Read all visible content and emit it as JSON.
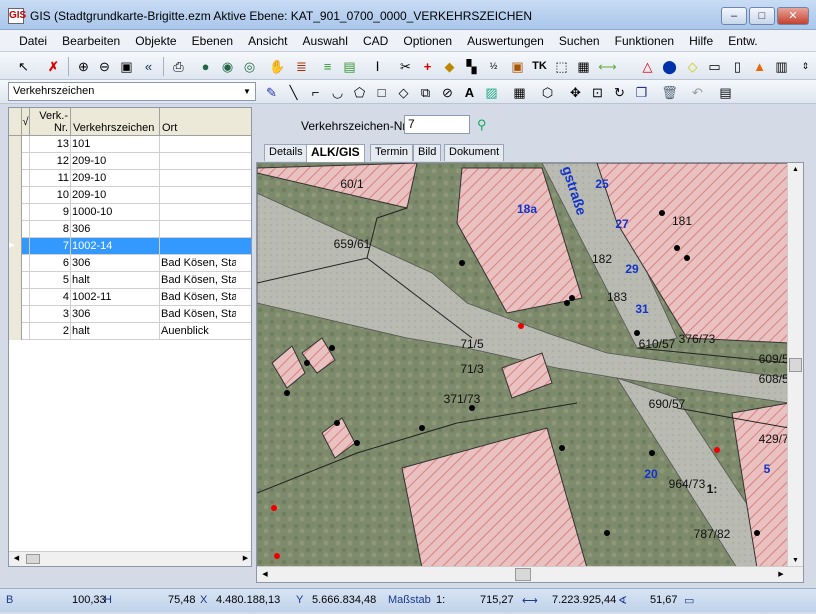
{
  "window": {
    "title": "GIS (Stadtgrundkarte-Brigitte.ezm Aktive Ebene: KAT_901_0700_0000_VERKEHRSZEICHEN",
    "icon_text": "GIS",
    "min": "–",
    "max": "□",
    "close": "✕"
  },
  "menu": [
    "Datei",
    "Bearbeiten",
    "Objekte",
    "Ebenen",
    "Ansicht",
    "Auswahl",
    "CAD",
    "Optionen",
    "Auswertungen",
    "Suchen",
    "Funktionen",
    "Hilfe",
    "Entw."
  ],
  "layer_select": {
    "value": "Verkehrszeichen"
  },
  "grid": {
    "headers": {
      "check": "√",
      "nr": "Verk.-Nr.",
      "zeichen": "Verkehrszeichen",
      "ort": "Ort"
    },
    "rows": [
      {
        "nr": "13",
        "zeichen": "101",
        "ort": ""
      },
      {
        "nr": "12",
        "zeichen": "209-10",
        "ort": ""
      },
      {
        "nr": "11",
        "zeichen": "209-10",
        "ort": ""
      },
      {
        "nr": "10",
        "zeichen": "209-10",
        "ort": ""
      },
      {
        "nr": "9",
        "zeichen": "1000-10",
        "ort": ""
      },
      {
        "nr": "8",
        "zeichen": "306",
        "ort": ""
      },
      {
        "nr": "7",
        "zeichen": "1002-14",
        "ort": ""
      },
      {
        "nr": "6",
        "zeichen": "306",
        "ort": "Bad Kösen, Sta"
      },
      {
        "nr": "5",
        "zeichen": "halt",
        "ort": "Bad Kösen, Sta"
      },
      {
        "nr": "4",
        "zeichen": "1002-11",
        "ort": "Bad Kösen, Sta"
      },
      {
        "nr": "3",
        "zeichen": "306",
        "ort": "Bad Kösen, Sta"
      },
      {
        "nr": "2",
        "zeichen": "halt",
        "ort": "Auenblick"
      }
    ]
  },
  "detail": {
    "label": "Verkehrszeichen-Nr.",
    "value": "7"
  },
  "tabs": [
    "Details",
    "ALK/GIS",
    "Termin",
    "Bild",
    "Dokument"
  ],
  "map": {
    "street": "gstraße",
    "parcels": [
      "60/1",
      "659/61",
      "71/5",
      "71/3",
      "371/73",
      "610/57",
      "609/57",
      "608/58",
      "690/57",
      "429/73",
      "964/73",
      "787/82",
      "376/73"
    ],
    "houses": [
      "181",
      "182",
      "183",
      "25",
      "27",
      "29",
      "31",
      "18a",
      "20",
      "5",
      "1:"
    ]
  },
  "status": {
    "mode": "B",
    "h": "100,33",
    "h_unit": "H",
    "x_val": "75,48",
    "x_unit": "X",
    "y_val": "4.480.188,13",
    "y_unit": "Y",
    "east": "5.666.834,48",
    "scale_label": "Maßstab",
    "scale_pre": "1:",
    "scale": "715,27",
    "dist": "7.223.925,44",
    "angle": "51,67"
  }
}
